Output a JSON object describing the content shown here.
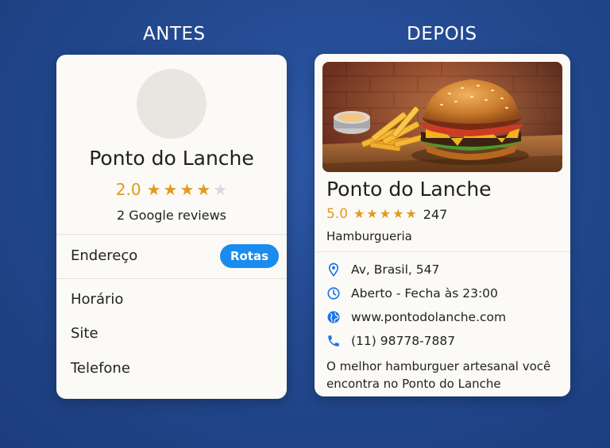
{
  "labels": {
    "before": "ANTES",
    "after": "DEPOIS"
  },
  "before_card": {
    "name": "Ponto do Lanche",
    "rating": "2.0",
    "stars": [
      "★",
      "★",
      "★",
      "★",
      "★"
    ],
    "stars_filled": 4,
    "reviews": "2 Google reviews",
    "address_label": "Endereço",
    "route_button": "Rotas",
    "hours_label": "Horário",
    "site_label": "Site",
    "phone_label": "Telefone"
  },
  "after_card": {
    "name": "Ponto do Lanche",
    "rating": "5.0",
    "stars": [
      "★",
      "★",
      "★",
      "★",
      "★"
    ],
    "review_count": "247",
    "category": "Hamburgueria",
    "address": "Av, Brasil, 547",
    "hours": "Aberto - Fecha às 23:00",
    "website": "www.pontodolanche.com",
    "phone": "(11) 98778-7887",
    "description": "O melhor hamburguer artesanal você encontra no Ponto do Lanche",
    "icons": [
      "location-pin-icon",
      "clock-icon",
      "globe-icon",
      "phone-icon"
    ]
  },
  "colors": {
    "accent_blue": "#1a8cf0",
    "star_gold": "#e39a1d",
    "background": "#23498f"
  }
}
